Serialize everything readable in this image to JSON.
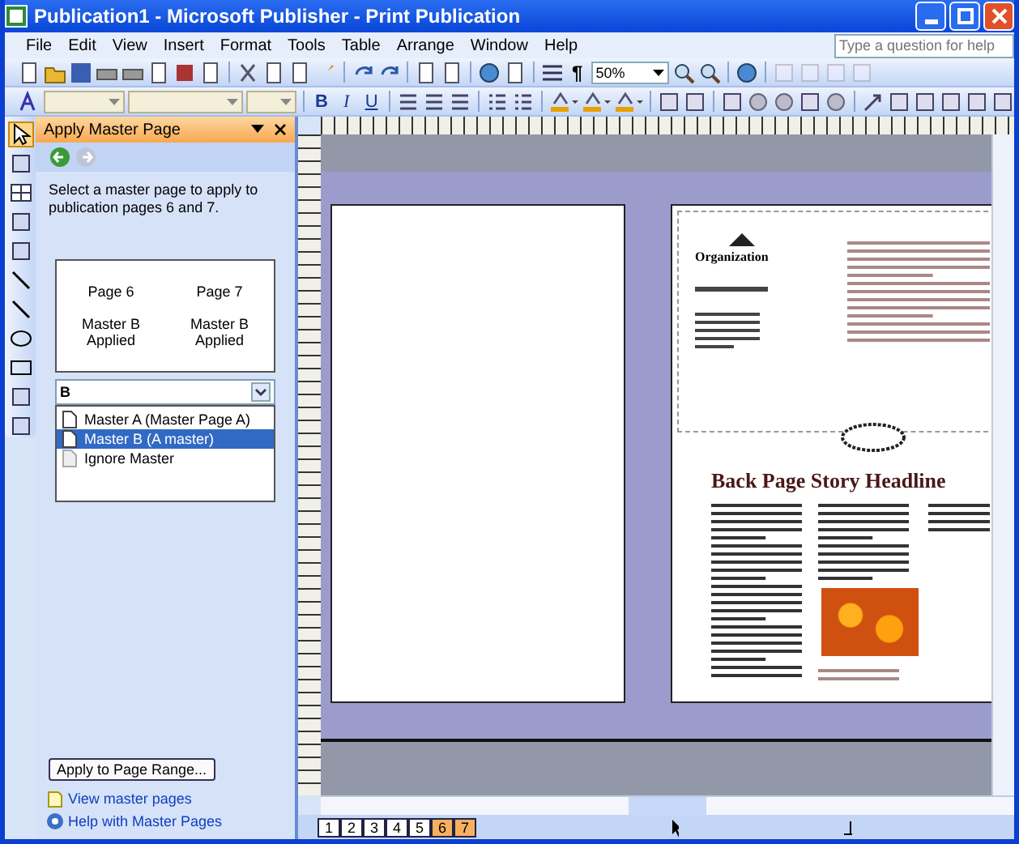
{
  "window": {
    "title": "Publication1 - Microsoft Publisher - Print Publication"
  },
  "menu": [
    "File",
    "Edit",
    "View",
    "Insert",
    "Format",
    "Tools",
    "Table",
    "Arrange",
    "Window",
    "Help"
  ],
  "help_search": {
    "placeholder": "Type a question for help"
  },
  "standard_toolbar": {
    "paragraph_mark": "¶",
    "zoom": "50%"
  },
  "formatting_toolbar": {
    "bold": "B",
    "italic": "I",
    "underline": "U"
  },
  "task_pane": {
    "title": "Apply Master Page",
    "instructions": "Select a master page to apply to publication pages 6 and 7.",
    "preview": [
      {
        "page": "Page 6",
        "status": "Master B Applied"
      },
      {
        "page": "Page 7",
        "status": "Master B Applied"
      }
    ],
    "master_dropdown": "B",
    "masters": [
      {
        "label": "Master A (Master Page A)",
        "selected": false
      },
      {
        "label": "Master B (A master)",
        "selected": true
      },
      {
        "label": "Ignore Master",
        "selected": false
      }
    ],
    "apply_button": "Apply to Page Range...",
    "links": [
      "View master pages",
      "Help with Master Pages"
    ]
  },
  "document": {
    "organization": "Organization",
    "headline": "Back Page Story Headline"
  },
  "page_tabs": [
    {
      "label": "1",
      "selected": false
    },
    {
      "label": "2",
      "selected": false
    },
    {
      "label": "3",
      "selected": false
    },
    {
      "label": "4",
      "selected": false
    },
    {
      "label": "5",
      "selected": false
    },
    {
      "label": "6",
      "selected": true
    },
    {
      "label": "7",
      "selected": true
    }
  ]
}
